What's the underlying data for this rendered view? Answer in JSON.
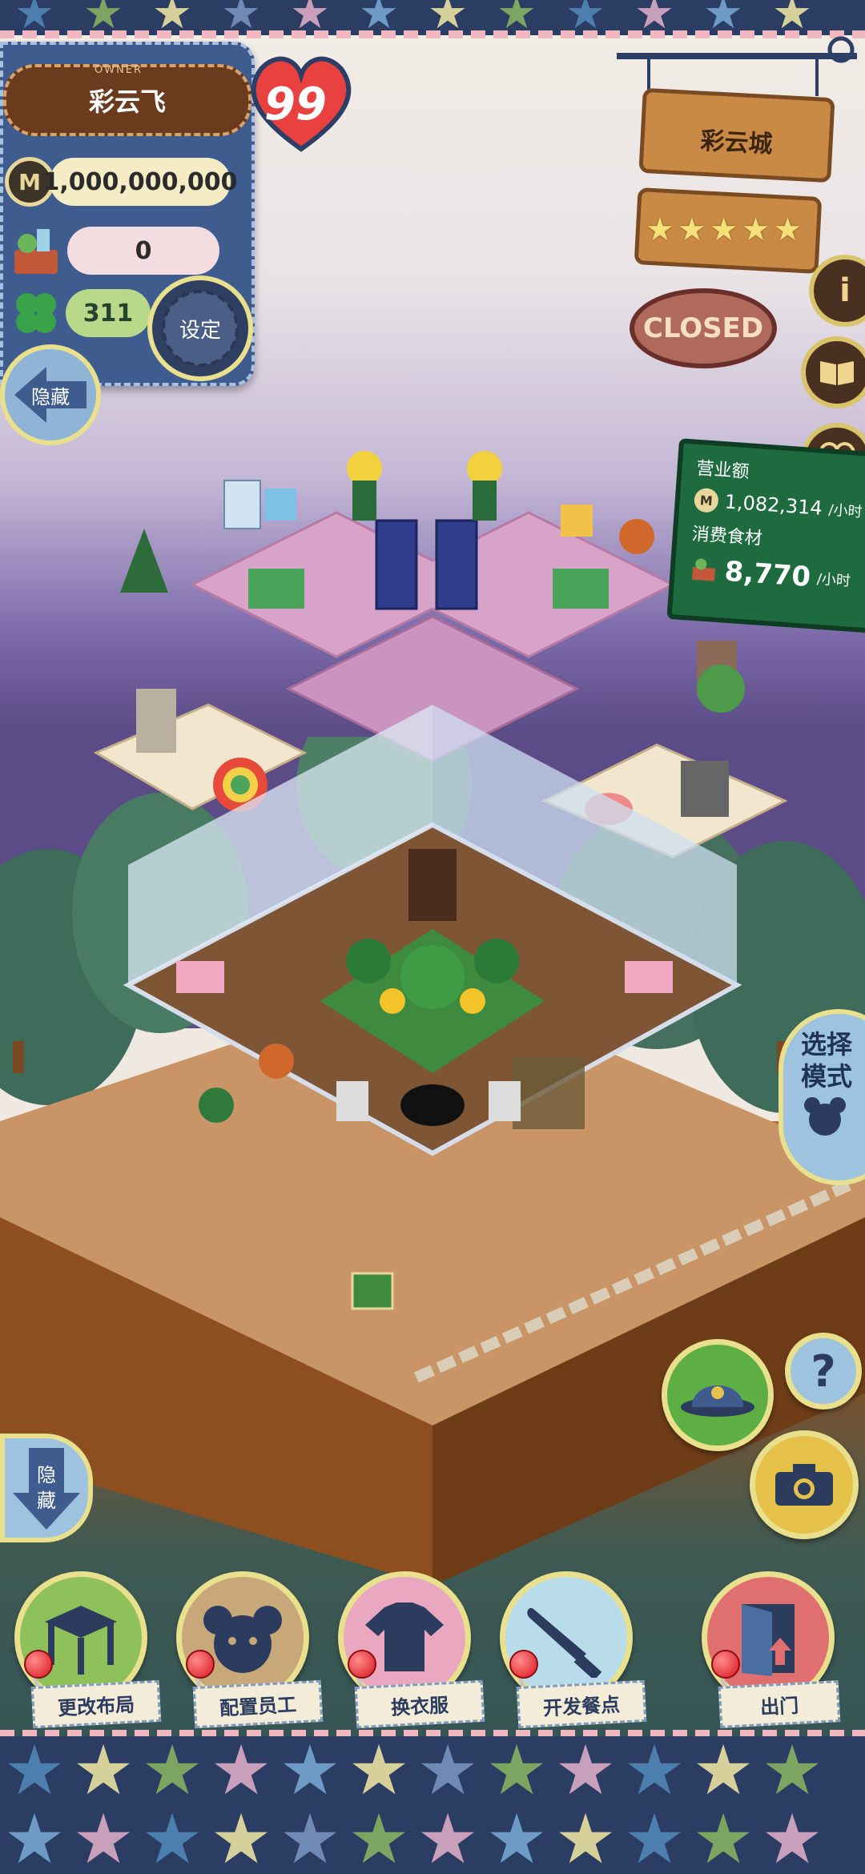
{
  "owner": {
    "tag": "OWNER",
    "name": "彩云飞",
    "level_badge": "99",
    "coins": "1,000,000,000",
    "coin_symbol": "M",
    "ingredients": "0",
    "clovers": "311",
    "settings_label": "设定",
    "hide_label": "隐藏"
  },
  "shop_sign": {
    "town_name": "彩云城",
    "star_rating": 5,
    "status": "CLOSED",
    "info_icon": "i",
    "buttons": [
      "info-icon",
      "book-icon",
      "heart-icon"
    ]
  },
  "revenue_board": {
    "sales_label": "营业额",
    "sales_value": "1,082,314",
    "sales_unit": "/小时",
    "food_label": "消费食材",
    "food_value": "8,770",
    "food_unit": "/小时"
  },
  "side_buttons": {
    "select_mode_line1": "选择",
    "select_mode_line2": "模式",
    "help_symbol": "?",
    "hide_line1": "隐",
    "hide_line2": "藏"
  },
  "bottom_menu": [
    {
      "label": "更改布局",
      "icon": "table-icon",
      "color": "#8fc15a"
    },
    {
      "label": "配置员工",
      "icon": "bear-icon",
      "color": "#c8a779"
    },
    {
      "label": "换衣服",
      "icon": "shirt-icon",
      "color": "#e9a8c0"
    },
    {
      "label": "开发餐点",
      "icon": "knife-icon",
      "color": "#b8dcea"
    },
    {
      "label": "出门",
      "icon": "door-icon",
      "color": "#e07070"
    }
  ],
  "colors": {
    "panel_blue": "#3e5c8e",
    "stitch_yellow": "#e8e08c",
    "board_green": "#1f6b40",
    "wood": "#c98a45"
  }
}
